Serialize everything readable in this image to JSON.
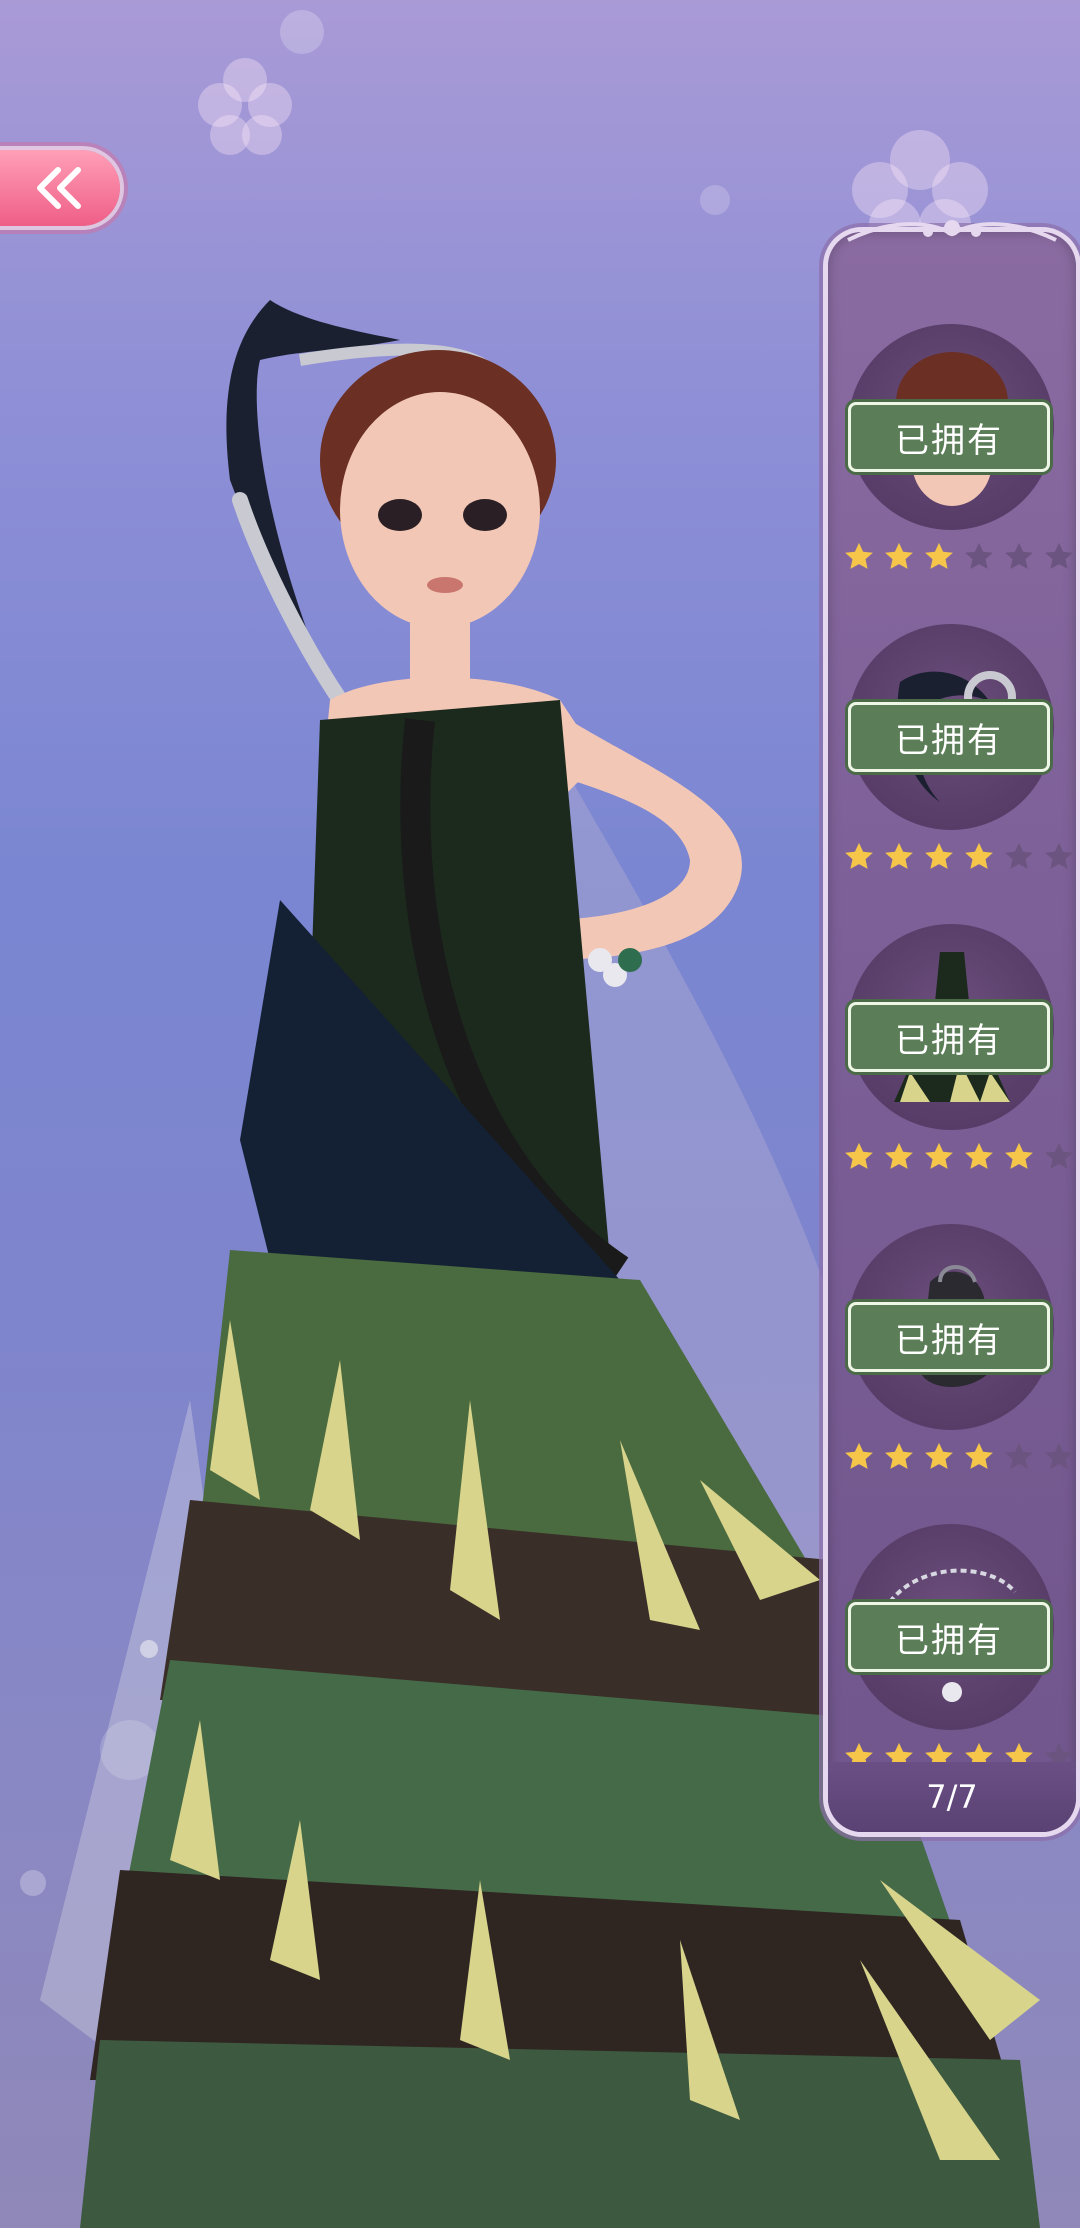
{
  "back_button": {
    "icon": "double-chevron-left-icon"
  },
  "items": [
    {
      "name": "hair",
      "owned_label": "已拥有",
      "rating": 3,
      "max_rating": 6
    },
    {
      "name": "headpiece",
      "owned_label": "已拥有",
      "rating": 4,
      "max_rating": 6
    },
    {
      "name": "dress",
      "owned_label": "已拥有",
      "rating": 5,
      "max_rating": 6
    },
    {
      "name": "shoes",
      "owned_label": "已拥有",
      "rating": 4,
      "max_rating": 6
    },
    {
      "name": "bracelet",
      "owned_label": "已拥有",
      "rating": 5,
      "max_rating": 6
    }
  ],
  "page_indicator": "7/7",
  "colors": {
    "star_on": "#f5c64a",
    "star_off": "#6b5580",
    "owned_badge": "#5b7d57",
    "back_button": "#ef5e86"
  }
}
